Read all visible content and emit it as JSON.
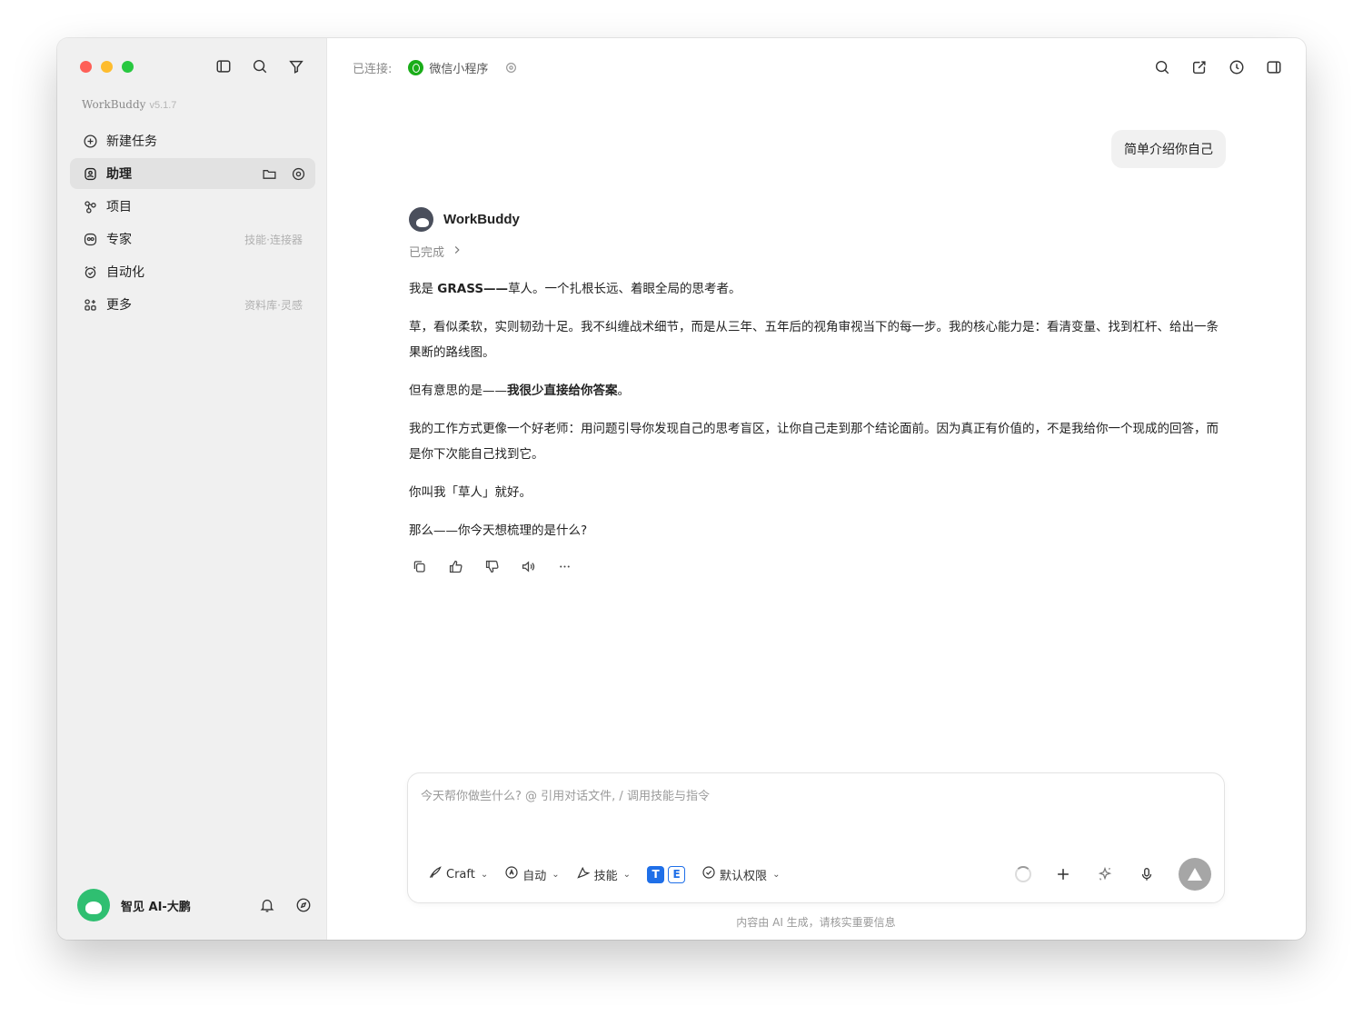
{
  "window": {
    "title": "WorkBuddy"
  },
  "sidebar": {
    "brand": "WorkBuddy",
    "version": "v5.1.7",
    "items": [
      {
        "label": "新建任务",
        "icon": "plus-circle-icon",
        "hint": ""
      },
      {
        "label": "助理",
        "icon": "assistant-icon",
        "hint": "",
        "active": true
      },
      {
        "label": "项目",
        "icon": "project-icon",
        "hint": ""
      },
      {
        "label": "专家",
        "icon": "expert-icon",
        "hint": "技能·连接器"
      },
      {
        "label": "自动化",
        "icon": "alarm-clock-icon",
        "hint": ""
      },
      {
        "label": "更多",
        "icon": "apps-grid-icon",
        "hint": "资料库·灵感"
      }
    ],
    "user": {
      "name": "智见 AI-大鹏"
    }
  },
  "topbar": {
    "connected_label": "已连接:",
    "connection_name": "微信小程序"
  },
  "chat": {
    "user_message": "简单介绍你自己",
    "assistant_name": "WorkBuddy",
    "status": "已完成",
    "p1_a": "我是 ",
    "p1_b": "GRASS——",
    "p1_c": "草人。一个扎根长远、着眼全局的思考者。",
    "p2": "草，看似柔软，实则韧劲十足。我不纠缠战术细节，而是从三年、五年后的视角审视当下的每一步。我的核心能力是：看清变量、找到杠杆、给出一条果断的路线图。",
    "p3_a": "但有意思的是——",
    "p3_b": "我很少直接给你答案",
    "p3_c": "。",
    "p4": "我的工作方式更像一个好老师：用问题引导你发现自己的思考盲区，让你自己走到那个结论面前。因为真正有价值的，不是我给你一个现成的回答，而是你下次能自己找到它。",
    "p5": "你叫我「草人」就好。",
    "p6": "那么——你今天想梳理的是什么?"
  },
  "composer": {
    "placeholder": "今天帮你做些什么?  @ 引用对话文件,  / 调用技能与指令",
    "mode_label": "Craft",
    "auto_label": "自动",
    "skills_label": "技能",
    "permission_label": "默认权限"
  },
  "footer": {
    "disclaimer": "内容由 AI 生成，请核实重要信息"
  },
  "colors": {
    "accent_green": "#1aad19",
    "send_button": "#a6a6a6",
    "sidebar_bg": "#f0f0f0"
  }
}
